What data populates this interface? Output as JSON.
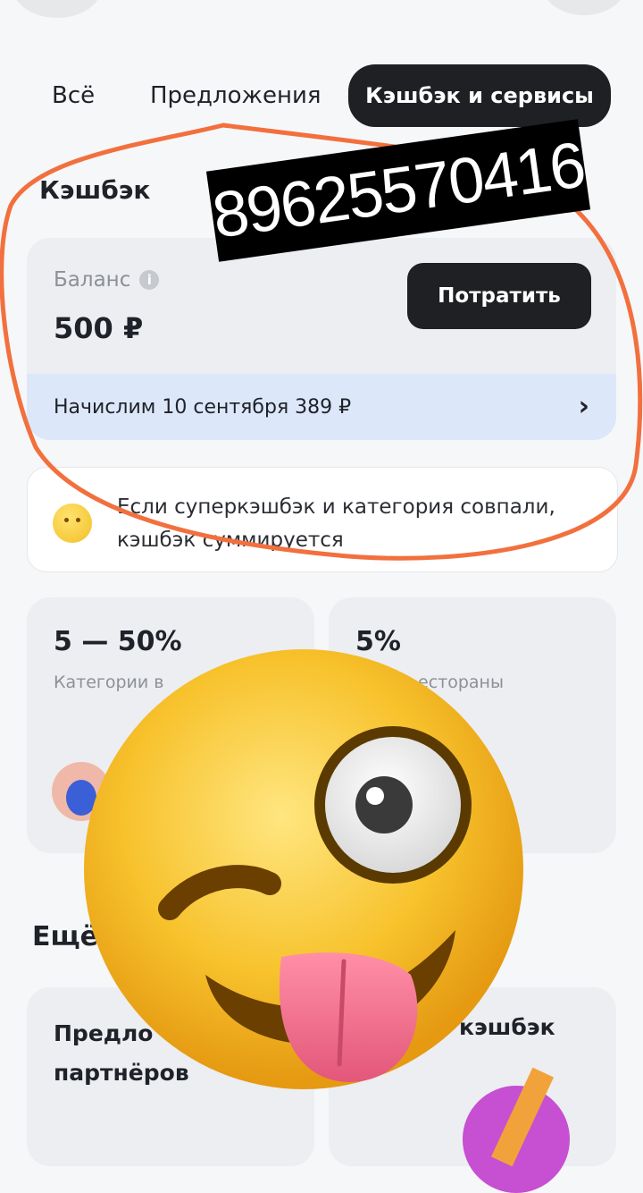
{
  "tabs": [
    {
      "label": "Всё"
    },
    {
      "label": "Предложения"
    },
    {
      "label": "Кэшбэк и сервисы"
    }
  ],
  "cashback": {
    "title": "Кэшбэк",
    "balance_label": "Баланс",
    "balance_value": "500 ₽",
    "spend_button": "Потратить",
    "accrual_text": "Начислим 10 сентября 389 ₽"
  },
  "note": {
    "text": "Если суперкэшбэк и категория совпали, кэшбэк суммируется"
  },
  "stats": [
    {
      "value": "5 — 50%",
      "label": "Категории в"
    },
    {
      "value": "5%",
      "label": "естораны"
    }
  ],
  "more": {
    "title": "Ещё"
  },
  "bottom_cards": [
    {
      "title_line1": "Предло",
      "title_line2": "партнёров"
    },
    {
      "title": "кэшбэк"
    }
  ],
  "annotations": {
    "phone_sticker": "89625570416",
    "scribble_color": "#f2703e"
  },
  "icons": {
    "info": "info-icon",
    "chevron": "chevron-right-icon",
    "emoji_sticker": "crazy-face-emoji"
  },
  "colors": {
    "active_tab": "#1f2023",
    "accrual_strip": "#dce8fa",
    "card_bg": "#eceef1"
  }
}
